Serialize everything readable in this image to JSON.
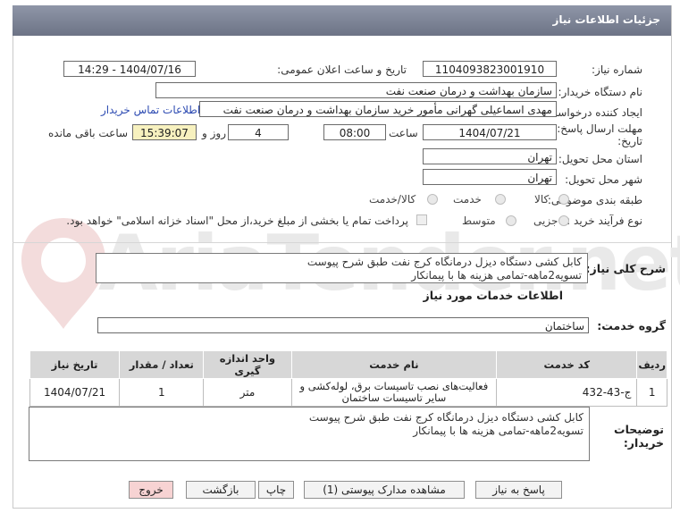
{
  "header": {
    "title": "جزئیات اطلاعات نیاز"
  },
  "watermark": {
    "text": "AriaTender.net"
  },
  "fields": {
    "need_number_label": "شماره نیاز:",
    "need_number": "1104093823001910",
    "announce_label": "تاریخ و ساعت اعلان عمومی:",
    "announce_value": "1404/07/16 - 14:29",
    "buyer_label": "نام دستگاه خریدار:",
    "buyer_value": "سازمان بهداشت و درمان صنعت نفت",
    "creator_label": "ایجاد کننده درخواست:",
    "creator_value": "مهدی اسماعیلی گهرانی مأمور خرید سازمان بهداشت و درمان صنعت نفت",
    "contact_link": "اطلاعات تماس خریدار",
    "deadline_label_1": "مهلت ارسال پاسخ: تا",
    "deadline_label_2": "تاریخ:",
    "deadline_date": "1404/07/21",
    "time_label": "ساعت",
    "deadline_time": "08:00",
    "days_value": "4",
    "days_label": "روز و",
    "remaining_time": "15:39:07",
    "remaining_label": "ساعت باقی مانده",
    "province_label": "استان محل تحویل:",
    "province_value": "تهران",
    "city_label": "شهر محل تحویل:",
    "city_value": "تهران",
    "category_label": "طبقه بندی موضوعی:",
    "category_options": [
      "کالا",
      "خدمت",
      "کالا/خدمت"
    ],
    "category_selected": "خدمت",
    "process_label": "نوع فرآیند خرید :",
    "process_options": [
      "جزیی",
      "متوسط"
    ],
    "payment_note": "پرداخت تمام یا بخشی از مبلغ خرید،از محل \"اسناد خزانه اسلامی\" خواهد بود."
  },
  "summary": {
    "label": "شرح کلی نیاز:",
    "line1": "کابل کشی دستگاه دیزل درمانگاه کرج نفت طبق شرح پیوست",
    "line2": "تسویه2ماهه-تمامی هزینه ها با پیمانکار"
  },
  "services": {
    "title": "اطلاعات خدمات مورد نیاز",
    "group_label": "گروه خدمت:",
    "group_value": "ساختمان",
    "columns": [
      "ردیف",
      "کد خدمت",
      "نام خدمت",
      "واحد اندازه گیری",
      "تعداد / مقدار",
      "تاریخ نیاز"
    ],
    "rows": [
      {
        "row": "1",
        "code": "ج-43-432",
        "name": "فعالیت‌های نصب تاسیسات برق، لوله‌کشی و سایر تاسیسات ساختمان",
        "unit": "متر",
        "qty": "1",
        "date": "1404/07/21"
      }
    ]
  },
  "buyer_notes": {
    "label_1": "توضیحات",
    "label_2": "خریدار:",
    "line1": "کابل کشی دستگاه دیزل درمانگاه کرج نفت طبق شرح پیوست",
    "line2": "تسویه2ماهه-تمامی هزینه ها با پیمانکار"
  },
  "buttons": {
    "reply": "پاسخ به نیاز",
    "docs": "مشاهده مدارک پیوستی (1)",
    "print": "چاپ",
    "back": "بازگشت",
    "exit": "خروج"
  },
  "colors": {
    "header": "#7b8194",
    "highlight": "#f7f1bf",
    "link": "#2d4bb2",
    "exit": "#f7d3d3"
  }
}
